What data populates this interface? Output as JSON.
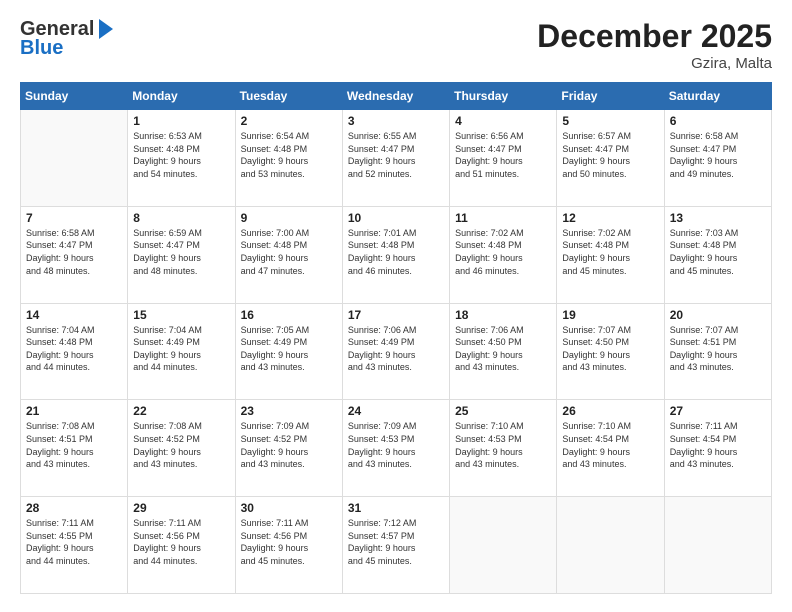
{
  "header": {
    "logo_general": "General",
    "logo_blue": "Blue",
    "month_title": "December 2025",
    "location": "Gzira, Malta"
  },
  "calendar": {
    "days_header": [
      "Sunday",
      "Monday",
      "Tuesday",
      "Wednesday",
      "Thursday",
      "Friday",
      "Saturday"
    ],
    "weeks": [
      [
        {
          "day": "",
          "info": ""
        },
        {
          "day": "1",
          "info": "Sunrise: 6:53 AM\nSunset: 4:48 PM\nDaylight: 9 hours\nand 54 minutes."
        },
        {
          "day": "2",
          "info": "Sunrise: 6:54 AM\nSunset: 4:48 PM\nDaylight: 9 hours\nand 53 minutes."
        },
        {
          "day": "3",
          "info": "Sunrise: 6:55 AM\nSunset: 4:47 PM\nDaylight: 9 hours\nand 52 minutes."
        },
        {
          "day": "4",
          "info": "Sunrise: 6:56 AM\nSunset: 4:47 PM\nDaylight: 9 hours\nand 51 minutes."
        },
        {
          "day": "5",
          "info": "Sunrise: 6:57 AM\nSunset: 4:47 PM\nDaylight: 9 hours\nand 50 minutes."
        },
        {
          "day": "6",
          "info": "Sunrise: 6:58 AM\nSunset: 4:47 PM\nDaylight: 9 hours\nand 49 minutes."
        }
      ],
      [
        {
          "day": "7",
          "info": "Sunrise: 6:58 AM\nSunset: 4:47 PM\nDaylight: 9 hours\nand 48 minutes."
        },
        {
          "day": "8",
          "info": "Sunrise: 6:59 AM\nSunset: 4:47 PM\nDaylight: 9 hours\nand 48 minutes."
        },
        {
          "day": "9",
          "info": "Sunrise: 7:00 AM\nSunset: 4:48 PM\nDaylight: 9 hours\nand 47 minutes."
        },
        {
          "day": "10",
          "info": "Sunrise: 7:01 AM\nSunset: 4:48 PM\nDaylight: 9 hours\nand 46 minutes."
        },
        {
          "day": "11",
          "info": "Sunrise: 7:02 AM\nSunset: 4:48 PM\nDaylight: 9 hours\nand 46 minutes."
        },
        {
          "day": "12",
          "info": "Sunrise: 7:02 AM\nSunset: 4:48 PM\nDaylight: 9 hours\nand 45 minutes."
        },
        {
          "day": "13",
          "info": "Sunrise: 7:03 AM\nSunset: 4:48 PM\nDaylight: 9 hours\nand 45 minutes."
        }
      ],
      [
        {
          "day": "14",
          "info": "Sunrise: 7:04 AM\nSunset: 4:48 PM\nDaylight: 9 hours\nand 44 minutes."
        },
        {
          "day": "15",
          "info": "Sunrise: 7:04 AM\nSunset: 4:49 PM\nDaylight: 9 hours\nand 44 minutes."
        },
        {
          "day": "16",
          "info": "Sunrise: 7:05 AM\nSunset: 4:49 PM\nDaylight: 9 hours\nand 43 minutes."
        },
        {
          "day": "17",
          "info": "Sunrise: 7:06 AM\nSunset: 4:49 PM\nDaylight: 9 hours\nand 43 minutes."
        },
        {
          "day": "18",
          "info": "Sunrise: 7:06 AM\nSunset: 4:50 PM\nDaylight: 9 hours\nand 43 minutes."
        },
        {
          "day": "19",
          "info": "Sunrise: 7:07 AM\nSunset: 4:50 PM\nDaylight: 9 hours\nand 43 minutes."
        },
        {
          "day": "20",
          "info": "Sunrise: 7:07 AM\nSunset: 4:51 PM\nDaylight: 9 hours\nand 43 minutes."
        }
      ],
      [
        {
          "day": "21",
          "info": "Sunrise: 7:08 AM\nSunset: 4:51 PM\nDaylight: 9 hours\nand 43 minutes."
        },
        {
          "day": "22",
          "info": "Sunrise: 7:08 AM\nSunset: 4:52 PM\nDaylight: 9 hours\nand 43 minutes."
        },
        {
          "day": "23",
          "info": "Sunrise: 7:09 AM\nSunset: 4:52 PM\nDaylight: 9 hours\nand 43 minutes."
        },
        {
          "day": "24",
          "info": "Sunrise: 7:09 AM\nSunset: 4:53 PM\nDaylight: 9 hours\nand 43 minutes."
        },
        {
          "day": "25",
          "info": "Sunrise: 7:10 AM\nSunset: 4:53 PM\nDaylight: 9 hours\nand 43 minutes."
        },
        {
          "day": "26",
          "info": "Sunrise: 7:10 AM\nSunset: 4:54 PM\nDaylight: 9 hours\nand 43 minutes."
        },
        {
          "day": "27",
          "info": "Sunrise: 7:11 AM\nSunset: 4:54 PM\nDaylight: 9 hours\nand 43 minutes."
        }
      ],
      [
        {
          "day": "28",
          "info": "Sunrise: 7:11 AM\nSunset: 4:55 PM\nDaylight: 9 hours\nand 44 minutes."
        },
        {
          "day": "29",
          "info": "Sunrise: 7:11 AM\nSunset: 4:56 PM\nDaylight: 9 hours\nand 44 minutes."
        },
        {
          "day": "30",
          "info": "Sunrise: 7:11 AM\nSunset: 4:56 PM\nDaylight: 9 hours\nand 45 minutes."
        },
        {
          "day": "31",
          "info": "Sunrise: 7:12 AM\nSunset: 4:57 PM\nDaylight: 9 hours\nand 45 minutes."
        },
        {
          "day": "",
          "info": ""
        },
        {
          "day": "",
          "info": ""
        },
        {
          "day": "",
          "info": ""
        }
      ]
    ]
  }
}
